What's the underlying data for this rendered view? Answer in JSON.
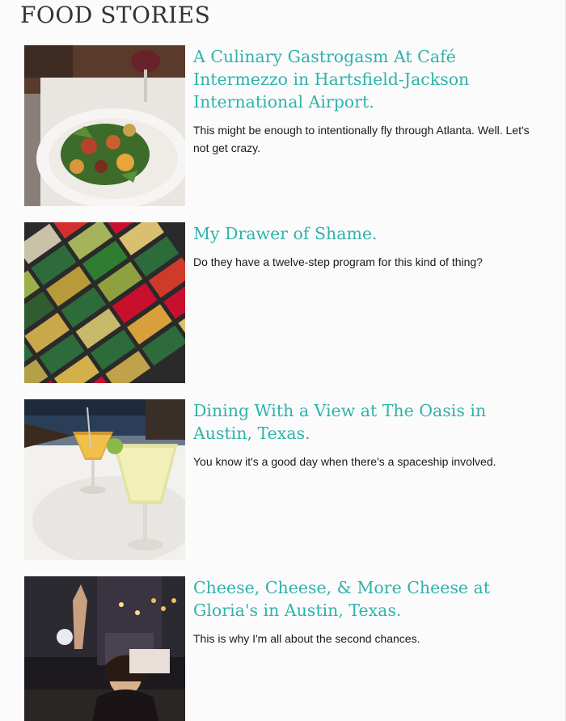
{
  "section": {
    "title": "FOOD STORIES"
  },
  "stories": [
    {
      "title": "A Culinary Gastrogasm At Café Intermezzo in Hartsfield-Jackson International Airport.",
      "excerpt": "This might be enough to intentionally fly through Atlanta. Well. Let's not get crazy."
    },
    {
      "title": "My Drawer of Shame.",
      "excerpt": "Do they have a twelve-step program for this kind of thing?"
    },
    {
      "title": "Dining With a View at The Oasis in Austin, Texas.",
      "excerpt": "You know it's a good day when there's a spaceship involved."
    },
    {
      "title": "Cheese, Cheese, & More Cheese at Gloria's in Austin, Texas.",
      "excerpt": "This is why I'm all about the second chances."
    }
  ],
  "colors": {
    "link": "#2fb3aa",
    "heading": "#333333",
    "text": "#1a1a1a"
  }
}
